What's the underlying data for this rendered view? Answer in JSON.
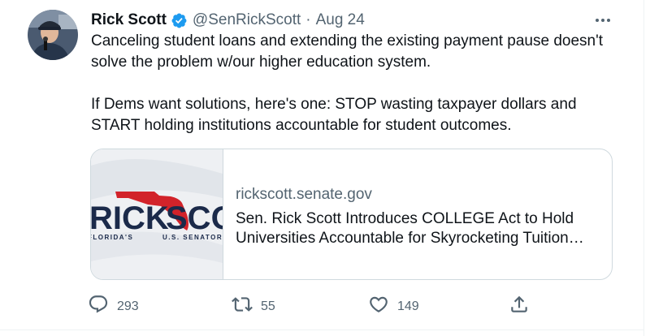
{
  "tweet": {
    "author_name": "Rick Scott",
    "handle": "@SenRickScott",
    "separator": "·",
    "date": "Aug 24",
    "text_paragraphs": [
      "Canceling student loans and extending the existing payment pause doesn't solve the problem w/our higher education system.",
      "If Dems want solutions, here's one: STOP wasting taxpayer dollars and START holding institutions accountable for student outcomes."
    ]
  },
  "card": {
    "domain": "rickscott.senate.gov",
    "title": "Sen. Rick Scott Introduces COLLEGE Act to Hold Universities Accountable for Skyrocketing Tuition…",
    "thumb_logo_left": "RICK",
    "thumb_logo_right": "SCOTT",
    "thumb_caption_left": "FLORIDA'S",
    "thumb_caption_right": "U.S. SENATOR"
  },
  "actions": {
    "reply_count": "293",
    "retweet_count": "55",
    "like_count": "149"
  },
  "icons": {
    "verified": "verified-badge-icon",
    "more": "more-options-icon",
    "reply": "reply-icon",
    "retweet": "retweet-icon",
    "like": "like-icon",
    "share": "share-icon"
  },
  "colors": {
    "verified_blue": "#1d9bf0",
    "text": "#0f1419",
    "secondary": "#536471",
    "logo_navy": "#1b2a4a",
    "logo_red": "#d2232a"
  }
}
